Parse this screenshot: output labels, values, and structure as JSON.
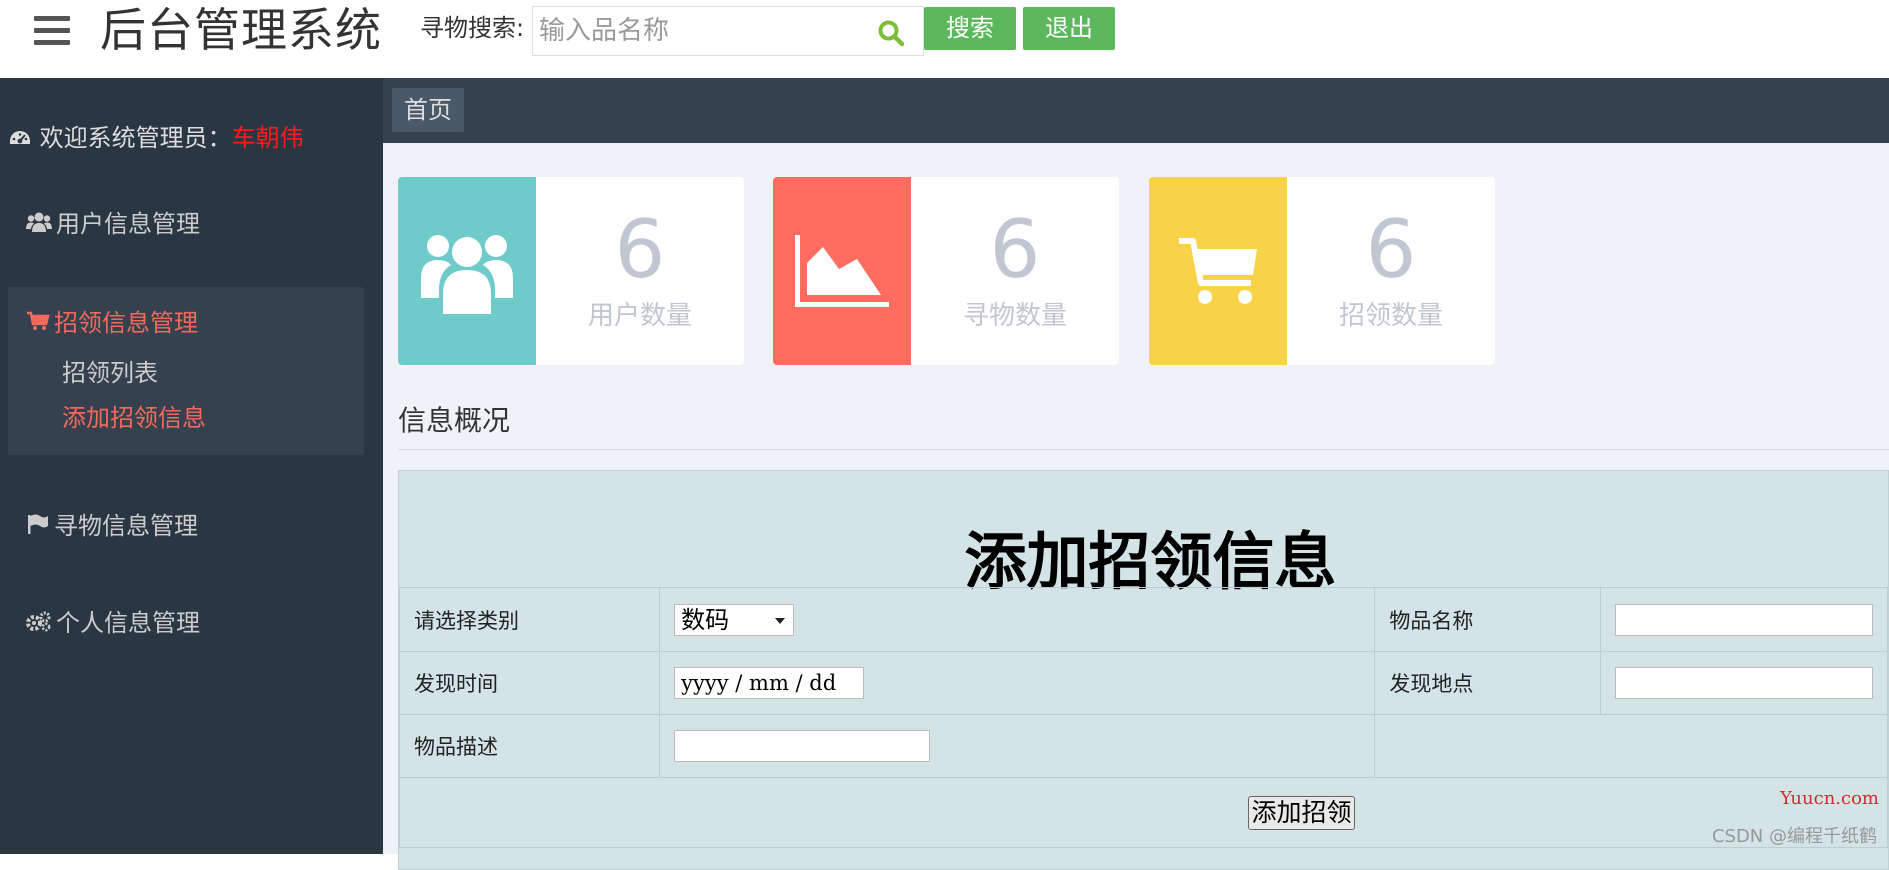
{
  "header": {
    "brand": "后台管理系统",
    "search_label": "寻物搜索:",
    "search_placeholder": "输入品名称",
    "search_button": "搜索",
    "logout_button": "退出"
  },
  "sidebar": {
    "welcome_prefix": "欢迎系统管理员：",
    "username": "车朝伟",
    "items": [
      {
        "label": "用户信息管理",
        "icon": "users-icon"
      },
      {
        "label": "招领信息管理",
        "icon": "shopping-cart-icon",
        "active": true,
        "children": [
          {
            "label": "招领列表"
          },
          {
            "label": "添加招领信息",
            "active": true
          }
        ]
      },
      {
        "label": "寻物信息管理",
        "icon": "flag-icon"
      },
      {
        "label": "个人信息管理",
        "icon": "gears-icon"
      }
    ]
  },
  "breadcrumb": {
    "home": "首页"
  },
  "stats": [
    {
      "value": "6",
      "label": "用户数量",
      "color": "#6ecbc9",
      "icon": "users-icon"
    },
    {
      "value": "6",
      "label": "寻物数量",
      "color": "#ff6c60",
      "icon": "area-chart-icon"
    },
    {
      "value": "6",
      "label": "招领数量",
      "color": "#f8d347",
      "icon": "shopping-cart-icon"
    }
  ],
  "section_title": "信息概况",
  "form": {
    "title": "添加招领信息",
    "category_label": "请选择类别",
    "category_value": "数码",
    "item_name_label": "物品名称",
    "item_name_value": "",
    "found_time_label": "发现时间",
    "found_time_placeholder": "yyyy / mm / dd",
    "found_place_label": "发现地点",
    "found_place_value": "",
    "description_label": "物品描述",
    "description_value": "",
    "submit_label": "添加招领"
  },
  "watermarks": {
    "site": "Yuucn.com",
    "author": "CSDN @编程千纸鹤"
  }
}
